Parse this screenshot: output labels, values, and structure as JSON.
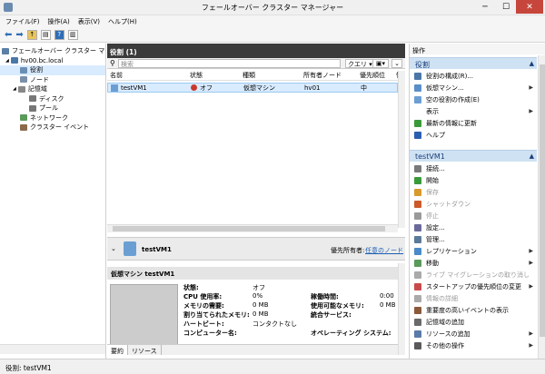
{
  "window": {
    "title": "フェールオーバー クラスター マネージャー",
    "controls": [
      "─",
      "☐",
      "✕"
    ]
  },
  "menu": [
    "ファイル(F)",
    "操作(A)",
    "表示(V)",
    "ヘルプ(H)"
  ],
  "tree": {
    "items": [
      {
        "label": "フェールオーバー クラスター マネージ",
        "indent": 0,
        "color": "#5b7fa6"
      },
      {
        "label": "hv00.bc.local",
        "indent": 1,
        "color": "#4b76a8"
      },
      {
        "label": "役割",
        "indent": 2,
        "color": "#6b8fb4",
        "selected": true
      },
      {
        "label": "ノード",
        "indent": 2,
        "color": "#7b8fa8"
      },
      {
        "label": "記憶域",
        "indent": 2,
        "color": "#888888"
      },
      {
        "label": "ディスク",
        "indent": 3,
        "color": "#777777"
      },
      {
        "label": "プール",
        "indent": 3,
        "color": "#777777"
      },
      {
        "label": "ネットワーク",
        "indent": 2,
        "color": "#5a9a5a"
      },
      {
        "label": "クラスター イベント",
        "indent": 2,
        "color": "#8a6a4a"
      }
    ]
  },
  "roles": {
    "header": "役割 (1)",
    "search_placeholder": "検索",
    "query_label": "クエリ",
    "columns": [
      "名前",
      "状態",
      "種類",
      "所有者ノード",
      "優先順位",
      "情"
    ],
    "rows": [
      {
        "name": "testVM1",
        "status": "オフ",
        "type": "仮想マシン",
        "owner": "hv01",
        "priority": "中",
        "info": ""
      }
    ]
  },
  "detail": {
    "vm_name": "testVM1",
    "preferred_owner_label": "優先所有者:",
    "preferred_owner_value": "任意のノード",
    "section_title": "仮想マシン testVM1",
    "left_labels": [
      "状態:",
      "CPU 使用率:",
      "メモリの需要:",
      "割り当てられたメモリ:",
      "ハートビート:",
      "コンピューター名:"
    ],
    "left_values": [
      "オフ",
      "0%",
      "0 MB",
      "0 MB",
      "コンタクトなし",
      ""
    ],
    "right_labels": [
      "稼働時間:",
      "使用可能なメモリ:",
      "統合サービス:",
      "",
      "オペレーティング システム:"
    ],
    "right_values": [
      "0:00",
      "0 MB",
      "",
      "",
      ""
    ],
    "tabs": [
      "要約",
      "リソース"
    ]
  },
  "actions": {
    "header": "操作",
    "section1": "役割",
    "section1_items": [
      {
        "label": "役割の構成(R)...",
        "icon": "configure-role",
        "color": "#4b76a8",
        "arrow": false,
        "disabled": false
      },
      {
        "label": "仮想マシン...",
        "icon": "virtual-machine",
        "color": "#5b8fc8",
        "arrow": true,
        "disabled": false
      },
      {
        "label": "空の役割の作成(E)",
        "icon": "empty-role",
        "color": "#6b9fd4",
        "arrow": false,
        "disabled": false
      },
      {
        "label": "表示",
        "icon": "",
        "color": "",
        "arrow": true,
        "disabled": false
      },
      {
        "label": "最新の情報に更新",
        "icon": "refresh",
        "color": "#3a9a3a",
        "arrow": false,
        "disabled": false
      },
      {
        "label": "ヘルプ",
        "icon": "help",
        "color": "#2a5fb0",
        "arrow": false,
        "disabled": false
      }
    ],
    "section2": "testVM1",
    "section2_items": [
      {
        "label": "接続...",
        "icon": "connect",
        "color": "#7a7a7a",
        "arrow": false,
        "disabled": false
      },
      {
        "label": "開始",
        "icon": "start",
        "color": "#3a9a3a",
        "arrow": false,
        "disabled": false
      },
      {
        "label": "保存",
        "icon": "save",
        "color": "#d89a2a",
        "arrow": false,
        "disabled": true
      },
      {
        "label": "シャットダウン",
        "icon": "shutdown",
        "color": "#cc5a2a",
        "arrow": false,
        "disabled": true
      },
      {
        "label": "停止",
        "icon": "stop",
        "color": "#9a9a9a",
        "arrow": false,
        "disabled": true
      },
      {
        "label": "設定...",
        "icon": "settings",
        "color": "#6a6a9a",
        "arrow": false,
        "disabled": false
      },
      {
        "label": "管理...",
        "icon": "manage",
        "color": "#5a7a9a",
        "arrow": false,
        "disabled": false
      },
      {
        "label": "レプリケーション",
        "icon": "replication",
        "color": "#4a8ac8",
        "arrow": true,
        "disabled": false
      },
      {
        "label": "移動",
        "icon": "move",
        "color": "#5a9a5a",
        "arrow": true,
        "disabled": false
      },
      {
        "label": "ライブ マイグレーションの取り消し",
        "icon": "cancel-migration",
        "color": "#aaaaaa",
        "arrow": false,
        "disabled": true
      },
      {
        "label": "スタートアップの優先順位の変更",
        "icon": "priority",
        "color": "#c84a4a",
        "arrow": true,
        "disabled": false
      },
      {
        "label": "情報の詳細",
        "icon": "info",
        "color": "#aaaaaa",
        "arrow": false,
        "disabled": true
      },
      {
        "label": "重要度の高いイベントの表示",
        "icon": "events",
        "color": "#8a5a3a",
        "arrow": false,
        "disabled": false
      },
      {
        "label": "記憶域の追加",
        "icon": "add-storage",
        "color": "#6a6a6a",
        "arrow": false,
        "disabled": false
      },
      {
        "label": "リソースの追加",
        "icon": "add-resource",
        "color": "#5a7aaa",
        "arrow": true,
        "disabled": false
      },
      {
        "label": "その他の操作",
        "icon": "more",
        "color": "#5a5a5a",
        "arrow": true,
        "disabled": false
      }
    ]
  },
  "status": "役割: testVM1"
}
